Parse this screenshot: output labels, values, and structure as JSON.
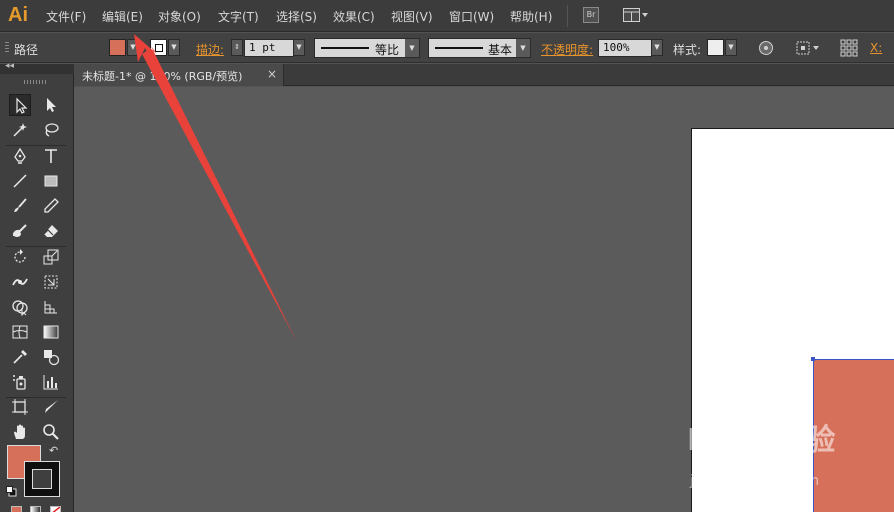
{
  "app": {
    "logo": "Ai"
  },
  "menubar": {
    "items": [
      {
        "label": "文件(F)"
      },
      {
        "label": "编辑(E)"
      },
      {
        "label": "对象(O)"
      },
      {
        "label": "文字(T)"
      },
      {
        "label": "选择(S)"
      },
      {
        "label": "效果(C)"
      },
      {
        "label": "视图(V)"
      },
      {
        "label": "窗口(W)"
      },
      {
        "label": "帮助(H)"
      }
    ],
    "bridge_label": "Br"
  },
  "controlbar": {
    "selection_type": "路径",
    "fill_color": "#d7705a",
    "stroke_label": "描边:",
    "stroke_weight": "1 pt",
    "profile_label": "等比",
    "brush_label": "基本",
    "opacity_label": "不透明度:",
    "opacity_value": "100%",
    "style_label": "样式:",
    "x_label": "X:"
  },
  "document_tab": {
    "title": "未标题-1* @ 100% (RGB/预览)",
    "close_label": "×"
  },
  "tools": {
    "fill_color": "#d7705a",
    "stroke_color": "#000000"
  },
  "watermark": {
    "logo": "Bai百经验",
    "url": "jingyan.baidu.com"
  },
  "annotation": {
    "arrow_color": "#e8423a"
  }
}
